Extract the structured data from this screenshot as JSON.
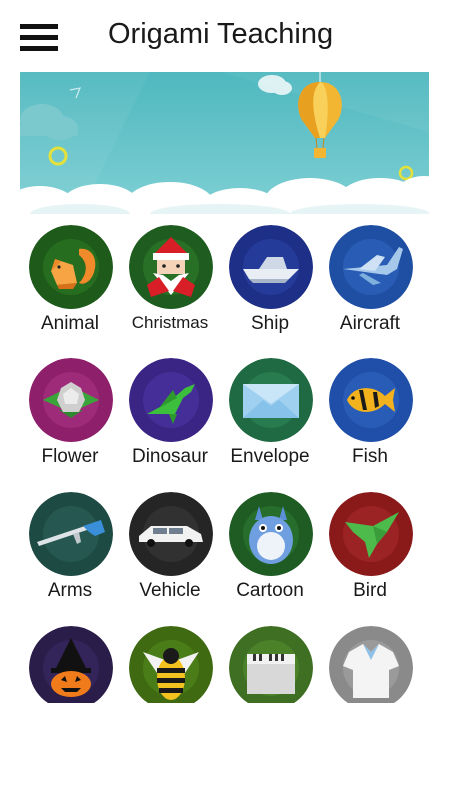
{
  "app": {
    "title": "Origami Teaching"
  },
  "toolbar": {
    "menu_icon": "hamburger-menu-icon"
  },
  "categories": [
    {
      "label": "Animal",
      "icon": "squirrel-icon",
      "bg": "#1e5a1a"
    },
    {
      "label": "Christmas",
      "icon": "santa-icon",
      "bg": "#1f5c1f"
    },
    {
      "label": "Ship",
      "icon": "ship-icon",
      "bg": "#1d2f86"
    },
    {
      "label": "Aircraft",
      "icon": "aircraft-icon",
      "bg": "#1f4fa3"
    },
    {
      "label": "Flower",
      "icon": "flower-icon",
      "bg": "#8e1f6a"
    },
    {
      "label": "Dinosaur",
      "icon": "dinosaur-icon",
      "bg": "#3a2585"
    },
    {
      "label": "Envelope",
      "icon": "envelope-icon",
      "bg": "#1f6a43"
    },
    {
      "label": "Fish",
      "icon": "fish-icon",
      "bg": "#1f4fa8"
    },
    {
      "label": "Arms",
      "icon": "gun-icon",
      "bg": "#1e4a44"
    },
    {
      "label": "Vehicle",
      "icon": "car-icon",
      "bg": "#252525"
    },
    {
      "label": "Cartoon",
      "icon": "totoro-icon",
      "bg": "#1e5c24"
    },
    {
      "label": "Bird",
      "icon": "bird-icon",
      "bg": "#8a1a1a"
    },
    {
      "label": "",
      "icon": "witch-pumpkin-icon",
      "bg": "#2a1d4a"
    },
    {
      "label": "",
      "icon": "bee-icon",
      "bg": "#3f6a12"
    },
    {
      "label": "",
      "icon": "piano-icon",
      "bg": "#3f6f22"
    },
    {
      "label": "",
      "icon": "shirt-icon",
      "bg": "#8a8a8a"
    }
  ]
}
